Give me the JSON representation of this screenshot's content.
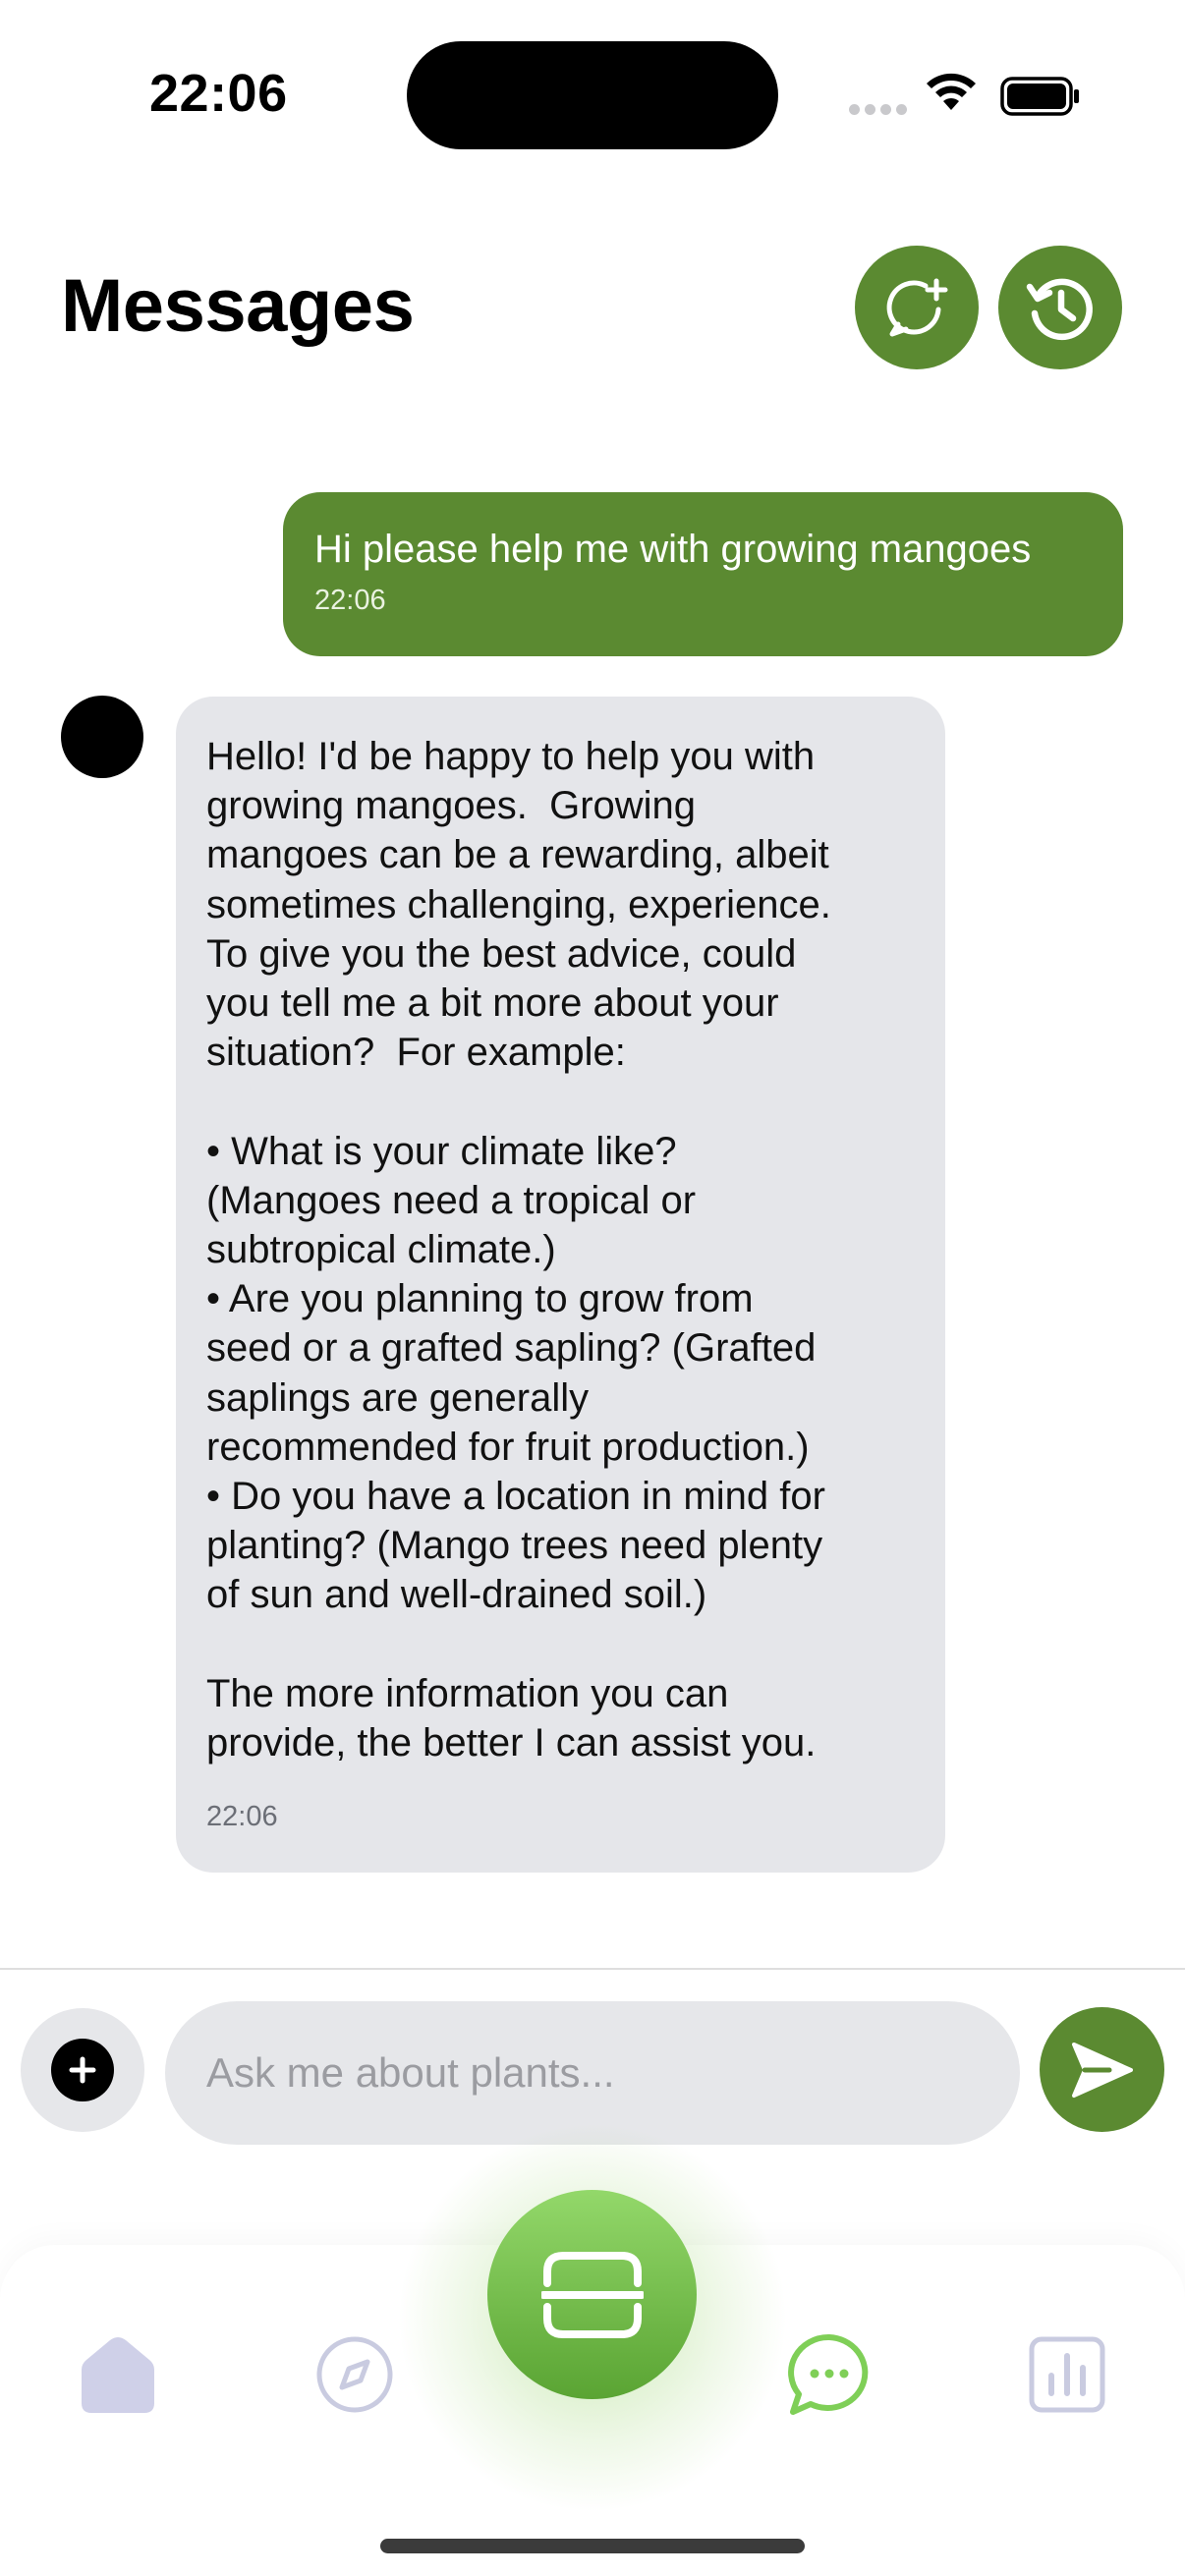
{
  "status_bar": {
    "time": "22:06"
  },
  "header": {
    "title": "Messages",
    "new_chat_icon": "chat-bubble-plus-icon",
    "history_icon": "history-clock-icon"
  },
  "messages": [
    {
      "sender": "user",
      "text": "Hi please help me with growing mangoes",
      "time": "22:06"
    },
    {
      "sender": "assistant",
      "text": "Hello! I'd be happy to help you with\ngrowing mangoes.  Growing\nmangoes can be a rewarding, albeit\nsometimes challenging, experience.\nTo give you the best advice, could\nyou tell me a bit more about your\nsituation?  For example:\n\n• What is your climate like?\n(Mangoes need a tropical or\nsubtropical climate.)\n• Are you planning to grow from\nseed or a grafted sapling? (Grafted\nsaplings are generally\nrecommended for fruit production.)\n• Do you have a location in mind for\nplanting? (Mango trees need plenty\nof sun and well-drained soil.)\n\nThe more information you can\nprovide, the better I can assist you.",
      "time": "22:06"
    }
  ],
  "composer": {
    "placeholder": "Ask me about plants...",
    "value": ""
  },
  "tabbar": {
    "items": [
      {
        "icon": "home-icon",
        "active": false
      },
      {
        "icon": "compass-icon",
        "active": false
      },
      {
        "icon": "scan-icon",
        "active": false
      },
      {
        "icon": "chat-icon",
        "active": true
      },
      {
        "icon": "stats-icon",
        "active": false
      }
    ]
  },
  "colors": {
    "accent": "#5b8a31",
    "bubble_bot": "#e5e6ea",
    "input_bg": "#e6e7ea",
    "tab_inactive": "#c9cbe0",
    "tab_active": "#7fcf57"
  }
}
